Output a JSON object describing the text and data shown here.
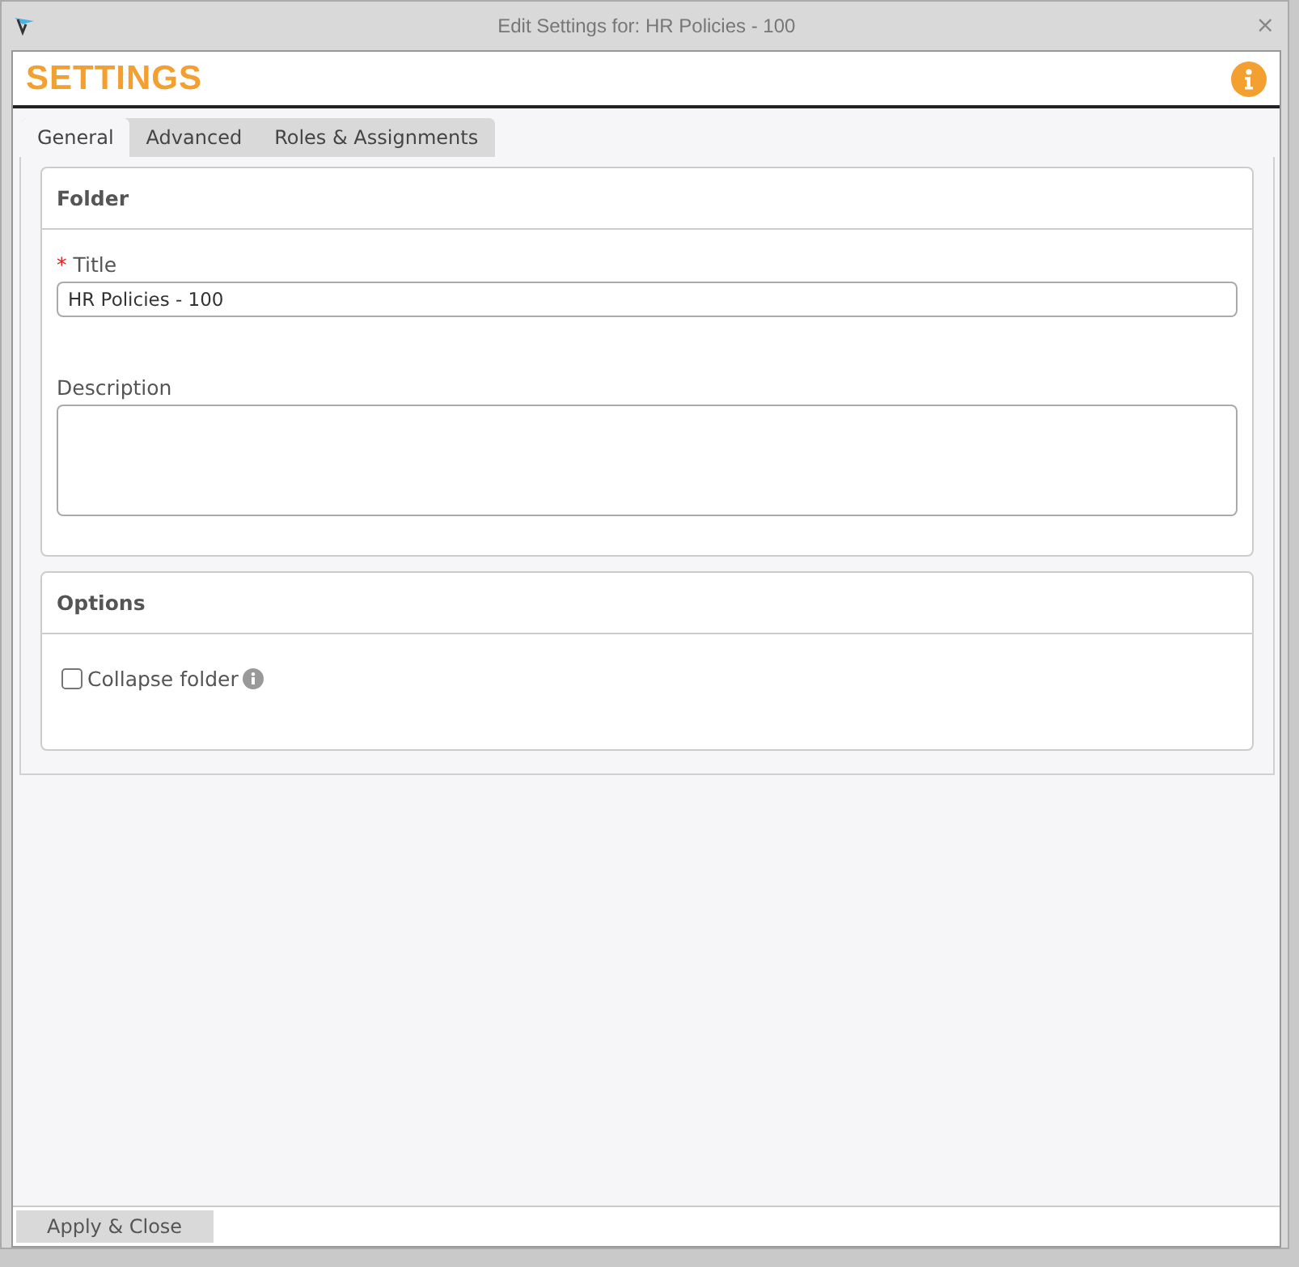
{
  "window": {
    "title": "Edit Settings for: HR Policies - 100",
    "close": "×"
  },
  "header": {
    "title": "SETTINGS"
  },
  "tabs": [
    {
      "label": "General",
      "selected": true
    },
    {
      "label": "Advanced",
      "selected": false
    },
    {
      "label": "Roles & Assignments",
      "selected": false
    }
  ],
  "sections": [
    {
      "title": "Folder",
      "fields": [
        {
          "kind": "text",
          "label": "Title",
          "required_mark": "*",
          "value": "HR Policies - 100"
        },
        {
          "kind": "textarea",
          "label": "Description"
        }
      ]
    },
    {
      "title": "Options",
      "fields": [
        {
          "kind": "checkbox",
          "label": "Collapse folder",
          "checked": false
        }
      ]
    }
  ],
  "footer": {
    "button": "Apply & Close"
  }
}
